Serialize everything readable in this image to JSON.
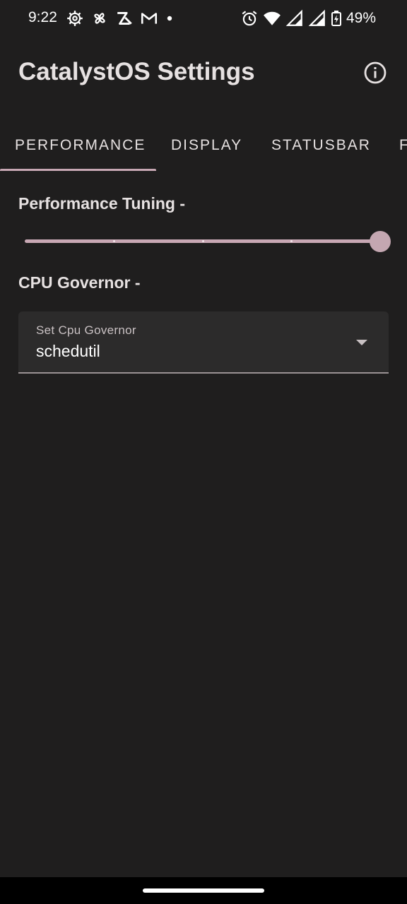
{
  "status_bar": {
    "time": "9:22",
    "battery": "49%",
    "left_icons": [
      "settings-gear-icon",
      "pinwheel-icon",
      "zoho-z-icon",
      "gmail-icon",
      "dot-icon"
    ],
    "right_icons": [
      "alarm-icon",
      "wifi-icon",
      "signal-icon",
      "signal-icon",
      "battery-charging-icon"
    ]
  },
  "appbar": {
    "title": "CatalystOS Settings",
    "info_icon": "info-icon"
  },
  "tabs": [
    {
      "label": "PERFORMANCE",
      "selected": true
    },
    {
      "label": "DISPLAY",
      "selected": false
    },
    {
      "label": "STATUSBAR",
      "selected": false
    },
    {
      "label": "F",
      "selected": false
    }
  ],
  "performance": {
    "tuning_label": "Performance Tuning -",
    "slider": {
      "steps": 5,
      "value_fraction": 1.0
    },
    "cpu_label": "CPU Governor -",
    "dropdown": {
      "label": "Set Cpu Governor",
      "value": "schedutil"
    }
  },
  "colors": {
    "background": "#1f1e1e",
    "accent": "#c8a8b4",
    "surface": "#2c2b2b"
  }
}
